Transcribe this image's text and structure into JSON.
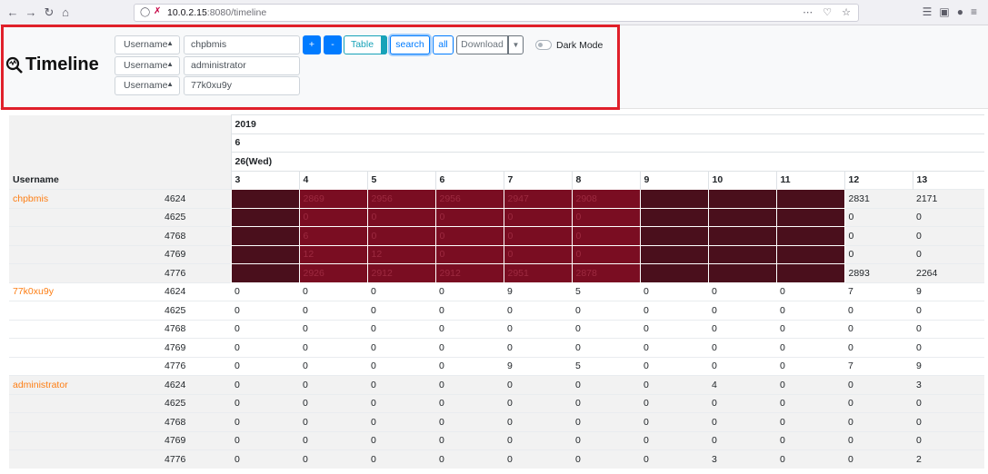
{
  "browser": {
    "url_host": "10.0.2.15",
    "url_rest": ":8080/timeline"
  },
  "header": {
    "logo_text": "Timeline",
    "filters": [
      {
        "field": "Username",
        "value": "chpbmis"
      },
      {
        "field": "Username",
        "value": "administrator"
      },
      {
        "field": "Username",
        "value": "77k0xu9y"
      }
    ],
    "buttons": {
      "plus": "+",
      "minus": "-",
      "table": "Table",
      "search": "search",
      "all": "all",
      "download": "Download"
    },
    "dark_mode_label": "Dark Mode",
    "dark_mode_on": false
  },
  "table": {
    "year": "2019",
    "month": "6",
    "day": "26(Wed)",
    "row_label_header": "Username",
    "hours": [
      "3",
      "4",
      "5",
      "6",
      "7",
      "8",
      "9",
      "10",
      "11",
      "12",
      "13"
    ],
    "groups": [
      {
        "user": "chpbmis",
        "rows": [
          {
            "event": "4624",
            "values": [
              "",
              "2869",
              "2956",
              "2956",
              "2947",
              "2908",
              "",
              "",
              "",
              "2831",
              "2171"
            ],
            "heat": [
              "dark",
              "mid",
              "mid",
              "mid",
              "mid",
              "mid",
              "dark",
              "dark",
              "dark",
              "",
              ""
            ]
          },
          {
            "event": "4625",
            "values": [
              "",
              "0",
              "0",
              "0",
              "0",
              "0",
              "",
              "",
              "",
              "0",
              "0"
            ],
            "heat": [
              "dark",
              "mid",
              "mid",
              "mid",
              "mid",
              "mid",
              "dark",
              "dark",
              "dark",
              "",
              ""
            ]
          },
          {
            "event": "4768",
            "values": [
              "",
              "6",
              "0",
              "0",
              "0",
              "0",
              "",
              "",
              "",
              "0",
              "0"
            ],
            "heat": [
              "dark",
              "mid",
              "mid",
              "mid",
              "mid",
              "mid",
              "dark",
              "dark",
              "dark",
              "",
              ""
            ]
          },
          {
            "event": "4769",
            "values": [
              "",
              "12",
              "12",
              "0",
              "0",
              "0",
              "",
              "",
              "",
              "0",
              "0"
            ],
            "heat": [
              "dark",
              "mid",
              "mid",
              "mid",
              "mid",
              "mid",
              "dark",
              "dark",
              "dark",
              "",
              ""
            ]
          },
          {
            "event": "4776",
            "values": [
              "",
              "2926",
              "2912",
              "2912",
              "2951",
              "2878",
              "",
              "",
              "",
              "2893",
              "2264"
            ],
            "heat": [
              "dark",
              "mid",
              "mid",
              "mid",
              "mid",
              "mid",
              "dark",
              "dark",
              "dark",
              "",
              ""
            ]
          }
        ]
      },
      {
        "user": "77k0xu9y",
        "rows": [
          {
            "event": "4624",
            "values": [
              "0",
              "0",
              "0",
              "0",
              "9",
              "5",
              "0",
              "0",
              "0",
              "7",
              "9"
            ]
          },
          {
            "event": "4625",
            "values": [
              "0",
              "0",
              "0",
              "0",
              "0",
              "0",
              "0",
              "0",
              "0",
              "0",
              "0"
            ]
          },
          {
            "event": "4768",
            "values": [
              "0",
              "0",
              "0",
              "0",
              "0",
              "0",
              "0",
              "0",
              "0",
              "0",
              "0"
            ]
          },
          {
            "event": "4769",
            "values": [
              "0",
              "0",
              "0",
              "0",
              "0",
              "0",
              "0",
              "0",
              "0",
              "0",
              "0"
            ]
          },
          {
            "event": "4776",
            "values": [
              "0",
              "0",
              "0",
              "0",
              "9",
              "5",
              "0",
              "0",
              "0",
              "7",
              "9"
            ]
          }
        ]
      },
      {
        "user": "administrator",
        "rows": [
          {
            "event": "4624",
            "values": [
              "0",
              "0",
              "0",
              "0",
              "0",
              "0",
              "0",
              "4",
              "0",
              "0",
              "3"
            ]
          },
          {
            "event": "4625",
            "values": [
              "0",
              "0",
              "0",
              "0",
              "0",
              "0",
              "0",
              "0",
              "0",
              "0",
              "0"
            ]
          },
          {
            "event": "4768",
            "values": [
              "0",
              "0",
              "0",
              "0",
              "0",
              "0",
              "0",
              "0",
              "0",
              "0",
              "0"
            ]
          },
          {
            "event": "4769",
            "values": [
              "0",
              "0",
              "0",
              "0",
              "0",
              "0",
              "0",
              "0",
              "0",
              "0",
              "0"
            ]
          },
          {
            "event": "4776",
            "values": [
              "0",
              "0",
              "0",
              "0",
              "0",
              "0",
              "0",
              "3",
              "0",
              "0",
              "2"
            ]
          }
        ]
      }
    ]
  }
}
